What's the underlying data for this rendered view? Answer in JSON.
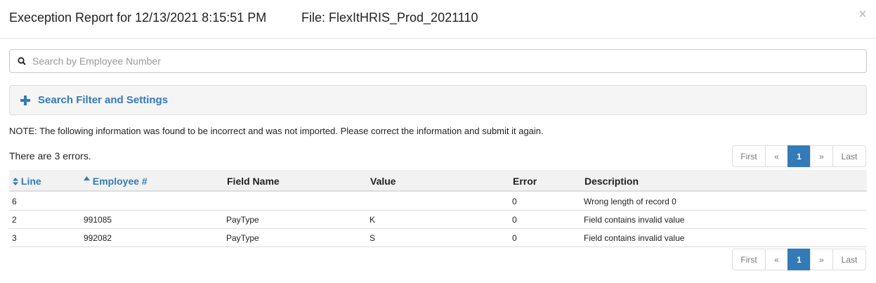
{
  "header": {
    "title": "Exeception Report for 12/13/2021 8:15:51 PM",
    "file": "File: FlexItHRIS_Prod_2021110",
    "close_glyph": "×"
  },
  "search": {
    "placeholder": "Search by Employee Number",
    "value": "",
    "icon": "search-icon"
  },
  "filter_panel": {
    "label": "Search Filter and Settings",
    "icon": "plus-icon"
  },
  "note": "NOTE: The following information was found to be incorrect and was not imported. Please correct the information and submit it again.",
  "error_count": "There are 3 errors.",
  "pagination": {
    "first": "First",
    "prev": "«",
    "current": "1",
    "next": "»",
    "last": "Last"
  },
  "table": {
    "columns": [
      {
        "label": "Line",
        "sort_icon": "sort-both-icon"
      },
      {
        "label": "Employee #",
        "sort_icon": "sort-asc-icon"
      },
      {
        "label": "Field Name"
      },
      {
        "label": "Value"
      },
      {
        "label": "Error"
      },
      {
        "label": "Description"
      }
    ],
    "rows": [
      {
        "line": "6",
        "employee": "",
        "field": "",
        "value": "",
        "error": "0",
        "description": "Wrong length of record 0"
      },
      {
        "line": "2",
        "employee": "991085",
        "field": "PayType",
        "value": "K",
        "error": "0",
        "description": "Field contains invalid value"
      },
      {
        "line": "3",
        "employee": "992082",
        "field": "PayType",
        "value": "S",
        "error": "0",
        "description": "Field contains invalid value"
      }
    ]
  },
  "colors": {
    "accent": "#337ab7",
    "panel_bg": "#f5f5f5",
    "border": "#dddddd"
  }
}
